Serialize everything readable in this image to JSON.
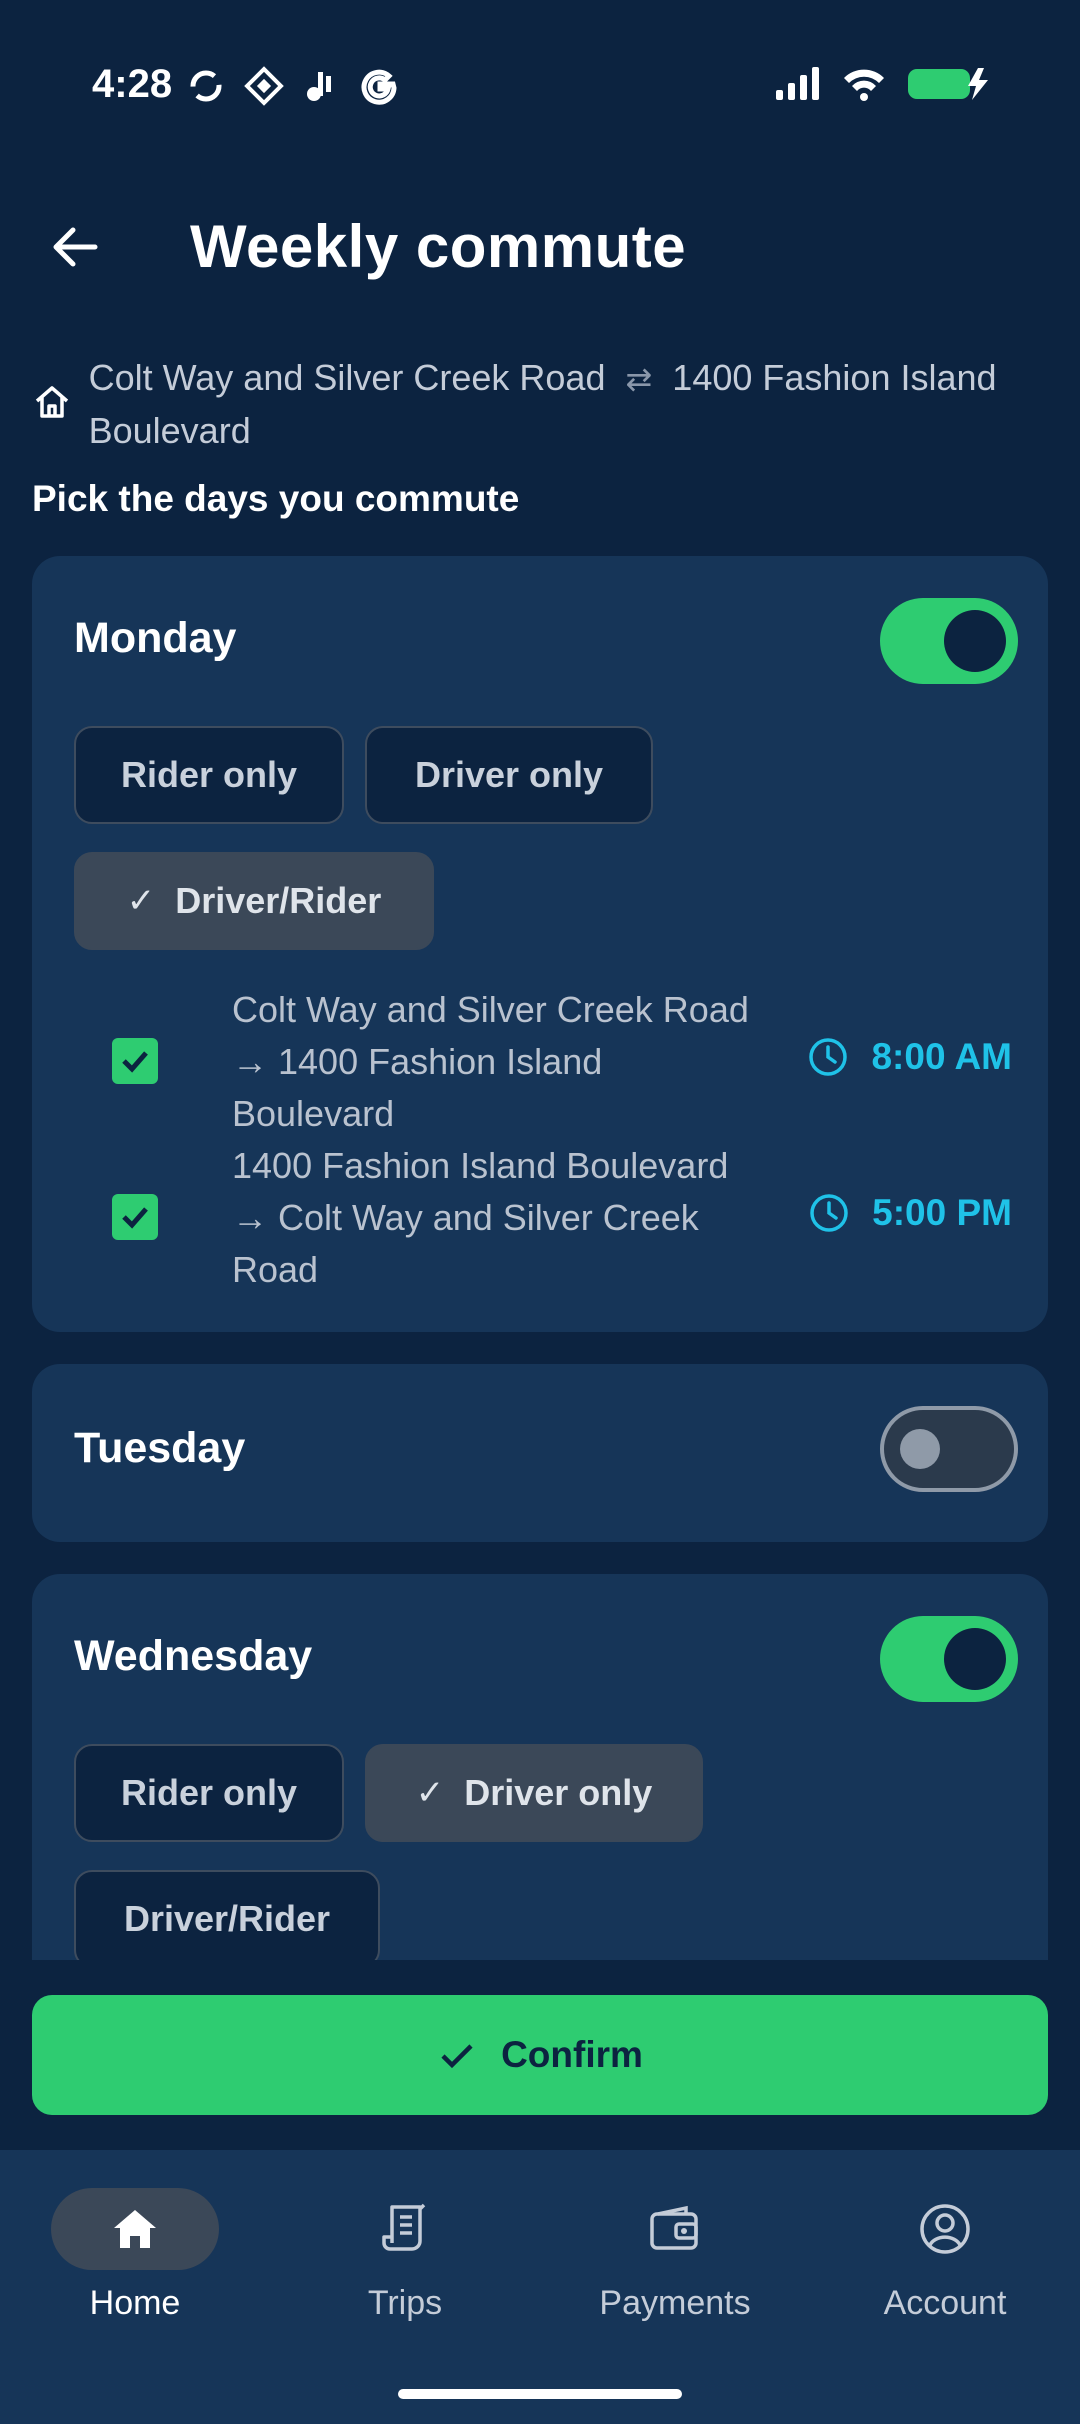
{
  "status_bar": {
    "time": "4:28",
    "left_icons": [
      "sync-icon",
      "sim-icon",
      "tiktok-icon",
      "google-icon"
    ],
    "right_icons": [
      "signal-icon",
      "wifi-icon",
      "battery-charging-icon"
    ]
  },
  "header": {
    "title": "Weekly commute",
    "back_icon": "arrow-left-icon"
  },
  "route": {
    "from": "Colt Way and Silver Creek Road",
    "swap_symbol": "⇄",
    "to": "1400 Fashion Island Boulevard"
  },
  "pick_label": "Pick the days you commute",
  "days": [
    {
      "name": "Monday",
      "enabled": true,
      "chips": [
        "Rider only",
        "Driver only",
        "Driver/Rider"
      ],
      "selected": "Driver/Rider",
      "trips": [
        {
          "label": "Colt Way and Silver Creek Road → 1400 Fashion Island Boulevard",
          "time": "8:00 AM",
          "checked": true
        },
        {
          "label": "1400 Fashion Island Boulevard → Colt Way and Silver Creek Road",
          "time": "5:00 PM",
          "checked": true
        }
      ]
    },
    {
      "name": "Tuesday",
      "enabled": false
    },
    {
      "name": "Wednesday",
      "enabled": true,
      "chips": [
        "Rider only",
        "Driver only",
        "Driver/Rider"
      ],
      "selected": "Driver only"
    }
  ],
  "confirm_label": "Confirm",
  "nav": [
    {
      "label": "Home",
      "icon": "home-icon",
      "active": true
    },
    {
      "label": "Trips",
      "icon": "receipt-icon",
      "active": false
    },
    {
      "label": "Payments",
      "icon": "wallet-icon",
      "active": false
    },
    {
      "label": "Account",
      "icon": "account-circle-icon",
      "active": false
    }
  ],
  "colors": {
    "background": "#0c2340",
    "card": "#163558",
    "accent_green": "#2ecc71",
    "time_blue": "#1fc2e8",
    "chip_selected": "#3b4858"
  }
}
